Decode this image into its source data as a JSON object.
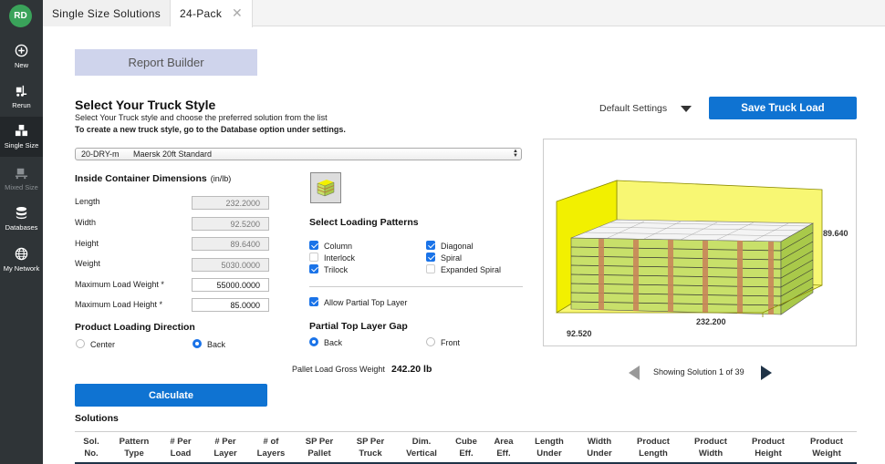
{
  "user": {
    "initials": "RD"
  },
  "sidebar": {
    "items": [
      {
        "label": "New",
        "icon": "plus-circle-icon"
      },
      {
        "label": "Rerun",
        "icon": "forklift-icon"
      },
      {
        "label": "Single Size",
        "icon": "boxes-icon"
      },
      {
        "label": "Mixed Size",
        "icon": "pallet-jack-icon"
      },
      {
        "label": "Databases",
        "icon": "database-icon"
      },
      {
        "label": "My Network",
        "icon": "globe-icon"
      }
    ]
  },
  "tabs": [
    {
      "label": "Single Size Solutions"
    },
    {
      "label": "24-Pack"
    }
  ],
  "report_builder": "Report Builder",
  "truck": {
    "title": "Select Your Truck Style",
    "subtitle": "Select Your Truck style and choose the preferred solution from the list",
    "note": "To create a new truck style, go to the Database option under settings.",
    "selected_code": "20-DRY-m",
    "selected_name": "Maersk 20ft Standard"
  },
  "settings": {
    "default_label": "Default Settings",
    "save_label": "Save Truck Load"
  },
  "dimensions": {
    "title": "Inside Container Dimensions",
    "unit": "(in/lb)",
    "fields": [
      {
        "label": "Length",
        "value": "232.2000"
      },
      {
        "label": "Width",
        "value": "92.5200"
      },
      {
        "label": "Height",
        "value": "89.6400"
      },
      {
        "label": "Weight",
        "value": "5030.0000"
      },
      {
        "label": "Maximum Load Weight *",
        "value": "55000.0000"
      },
      {
        "label": "Maximum Load Height *",
        "value": "85.0000"
      }
    ]
  },
  "direction": {
    "title": "Product Loading Direction",
    "options": [
      "Center",
      "Back"
    ],
    "selected": "Back"
  },
  "patterns": {
    "title": "Select Loading Patterns",
    "items": [
      {
        "label": "Column",
        "checked": true
      },
      {
        "label": "Interlock",
        "checked": false
      },
      {
        "label": "Trilock",
        "checked": true
      },
      {
        "label": "Diagonal",
        "checked": true
      },
      {
        "label": "Spiral",
        "checked": true
      },
      {
        "label": "Expanded Spiral",
        "checked": false
      }
    ],
    "allow_partial": "Allow Partial Top Layer",
    "allow_partial_checked": true
  },
  "gap": {
    "title": "Partial Top Layer Gap",
    "options": [
      "Back",
      "Front"
    ],
    "selected": "Back"
  },
  "gross": {
    "label": "Pallet Load Gross Weight",
    "value": "242.20 lb"
  },
  "preview": {
    "width_label": "92.520",
    "length_label": "232.200",
    "height_label": "89.640"
  },
  "solution_nav": {
    "text": "Showing Solution 1 of 39"
  },
  "calculate_label": "Calculate",
  "solutions": {
    "title": "Solutions",
    "columns": [
      [
        "Sol.",
        "No."
      ],
      [
        "Pattern",
        "Type"
      ],
      [
        "# Per",
        "Load"
      ],
      [
        "# Per",
        "Layer"
      ],
      [
        "# of",
        "Layers"
      ],
      [
        "SP Per",
        "Pallet"
      ],
      [
        "SP Per",
        "Truck"
      ],
      [
        "Dim.",
        "Vertical"
      ],
      [
        "Cube",
        "Eff."
      ],
      [
        "Area",
        "Eff."
      ],
      [
        "Length",
        "Under"
      ],
      [
        "Width",
        "Under"
      ],
      [
        "Product",
        "Length"
      ],
      [
        "Product",
        "Width"
      ],
      [
        "Product",
        "Height"
      ],
      [
        "Product",
        "Weight"
      ]
    ]
  },
  "colors": {
    "accent": "#0f73d2",
    "sidebar": "#2f3437",
    "cargo": "#c8e06a",
    "container": "#f2f000"
  }
}
